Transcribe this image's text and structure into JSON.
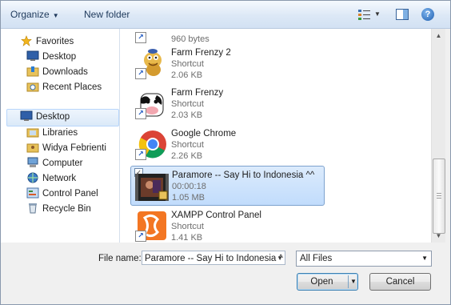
{
  "toolbar": {
    "organize_label": "Organize",
    "new_folder_label": "New folder"
  },
  "nav": {
    "favorites_header": "Favorites",
    "items": [
      {
        "label": "Desktop",
        "icon": "desktop-icon"
      },
      {
        "label": "Downloads",
        "icon": "downloads-folder-icon"
      },
      {
        "label": "Recent Places",
        "icon": "recent-places-icon"
      }
    ],
    "desktop_header": "Desktop",
    "tree": [
      {
        "label": "Libraries",
        "icon": "libraries-icon"
      },
      {
        "label": "Widya Febrienti",
        "icon": "user-folder-icon"
      },
      {
        "label": "Computer",
        "icon": "computer-icon"
      },
      {
        "label": "Network",
        "icon": "network-icon"
      },
      {
        "label": "Control Panel",
        "icon": "control-panel-icon"
      },
      {
        "label": "Recycle Bin",
        "icon": "recycle-bin-icon"
      }
    ]
  },
  "files": [
    {
      "name": "",
      "type": "",
      "size": "960 bytes",
      "icon": "shortcut-icon"
    },
    {
      "name": "Farm Frenzy 2",
      "type": "Shortcut",
      "size": "2.06 KB",
      "icon": "farm-frenzy-2-icon"
    },
    {
      "name": "Farm Frenzy",
      "type": "Shortcut",
      "size": "2.03 KB",
      "icon": "farm-frenzy-icon"
    },
    {
      "name": "Google Chrome",
      "type": "Shortcut",
      "size": "2.26 KB",
      "icon": "chrome-icon"
    },
    {
      "name": "Paramore -- Say Hi to Indonesia ^^",
      "type": "00:00:18",
      "size": "1.05 MB",
      "icon": "video-thumbnail-icon"
    },
    {
      "name": "XAMPP Control Panel",
      "type": "Shortcut",
      "size": "1.41 KB",
      "icon": "xampp-icon"
    }
  ],
  "bottom": {
    "file_name_label": "File name:",
    "file_name_value": "Paramore -- Say Hi to Indonesia ^",
    "file_type_value": "All Files",
    "open_label": "Open",
    "cancel_label": "Cancel"
  },
  "colors": {
    "selection": "#c1dcfc",
    "toolbar": "#dce8f6",
    "link_text": "#1e395b"
  }
}
